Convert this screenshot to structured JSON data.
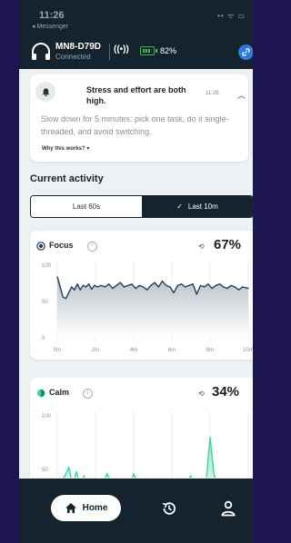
{
  "status_bar": {
    "time": "11:26",
    "back_app": "◂ Messenger",
    "icons": "•• ᯤ ▭"
  },
  "device": {
    "name": "MN8-D79D",
    "status": "Connected",
    "signal_icon": "((•))",
    "battery": "82%"
  },
  "alert": {
    "title": "Stress and effort are both high.",
    "time": "11:26",
    "body": "Slow down for 5 minutes: pick one task, do it single-threaded, and avoid switching.",
    "why_link": "Why this works? ▾"
  },
  "current_activity": {
    "title": "Current activity",
    "tabs": [
      {
        "label": "Last 60s",
        "selected": false
      },
      {
        "label": "Last 10m",
        "selected": true
      }
    ],
    "selected_check": "✓"
  },
  "cards": {
    "focus": {
      "title": "Focus",
      "value": "67%",
      "color": "#1f3e62"
    },
    "calm": {
      "title": "Calm",
      "value": "34%",
      "color": "#3fd69e"
    }
  },
  "chart_data": [
    {
      "type": "area",
      "name": "Focus",
      "y_ticks": [
        "100",
        "50",
        "0"
      ],
      "x_ticks": [
        "0m",
        "2m",
        "4m",
        "6m",
        "8m",
        "10m"
      ],
      "ylim": [
        0,
        100
      ],
      "xlim": [
        0,
        10
      ],
      "x": [
        0,
        0.15,
        0.3,
        0.45,
        0.6,
        0.75,
        0.9,
        1.05,
        1.2,
        1.35,
        1.5,
        1.65,
        1.8,
        1.95,
        2.1,
        2.3,
        2.5,
        2.7,
        2.9,
        3.1,
        3.3,
        3.5,
        3.7,
        3.9,
        4.1,
        4.3,
        4.5,
        4.7,
        4.9,
        5.1,
        5.3,
        5.5,
        5.7,
        5.9,
        6.1,
        6.3,
        6.5,
        6.7,
        6.9,
        7.1,
        7.3,
        7.5,
        7.7,
        7.9,
        8.1,
        8.3,
        8.5,
        8.7,
        8.9,
        9.1,
        9.3,
        9.5,
        9.7,
        10
      ],
      "values": [
        84,
        70,
        56,
        54,
        62,
        70,
        66,
        74,
        66,
        72,
        70,
        74,
        67,
        72,
        70,
        72,
        70,
        74,
        68,
        72,
        76,
        70,
        72,
        74,
        68,
        72,
        70,
        66,
        72,
        76,
        70,
        78,
        72,
        70,
        62,
        72,
        74,
        70,
        72,
        74,
        60,
        72,
        70,
        74,
        68,
        72,
        74,
        70,
        68,
        72,
        70,
        66,
        70,
        68
      ]
    },
    {
      "type": "area",
      "name": "Calm",
      "y_ticks": [
        "100",
        "50"
      ],
      "x_ticks": [],
      "ylim": [
        0,
        100
      ],
      "xlim": [
        0,
        10
      ],
      "x": [
        0,
        0.2,
        0.4,
        0.6,
        0.8,
        1.0,
        1.2,
        1.4,
        1.6,
        1.8,
        2.0,
        2.2,
        2.4,
        2.6,
        2.8,
        3.0,
        3.2,
        3.4,
        3.6,
        3.8,
        4.0,
        4.2,
        4.4,
        4.6,
        4.8,
        5.0,
        5.2,
        5.4,
        5.6,
        5.8,
        6.0,
        6.2,
        6.4,
        6.6,
        6.8,
        7.0,
        7.2,
        7.4,
        7.6,
        7.8,
        8.0,
        8.2,
        8.4,
        8.6,
        8.8,
        9.0,
        9.2,
        9.4,
        9.6,
        9.8,
        10
      ],
      "values": [
        38,
        40,
        44,
        52,
        36,
        48,
        34,
        44,
        32,
        38,
        42,
        30,
        36,
        46,
        40,
        32,
        38,
        40,
        32,
        36,
        46,
        38,
        36,
        32,
        40,
        30,
        34,
        36,
        32,
        38,
        34,
        30,
        36,
        32,
        40,
        44,
        34,
        32,
        30,
        40,
        80,
        46,
        34,
        36,
        32,
        38,
        34,
        30,
        34,
        30,
        32
      ]
    }
  ],
  "nav": {
    "home_label": "Home"
  }
}
